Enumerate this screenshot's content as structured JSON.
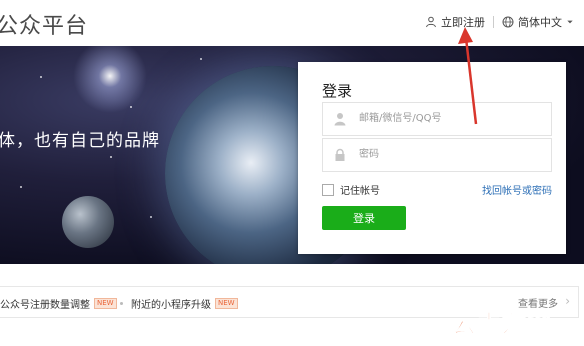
{
  "header": {
    "brand": "公众平台",
    "register_link": "立即注册",
    "language_link": "简体中文"
  },
  "banner": {
    "slogan": "体，也有自己的品牌"
  },
  "login": {
    "title": "登录",
    "account_placeholder": "邮箱/微信号/QQ号",
    "password_placeholder": "密码",
    "remember_label": "记住帐号",
    "forgot_link": "找回帐号或密码",
    "submit_label": "登录",
    "button_color": "#1aad19"
  },
  "notices": {
    "items": [
      {
        "text": "公众号注册数量调整",
        "badge": "NEW"
      },
      {
        "text": "附近的小程序升级",
        "badge": "NEW"
      }
    ],
    "more_label": "查看更多"
  },
  "watermark": "云南龙网",
  "colors": {
    "annotation_arrow": "#d9362c",
    "link": "#2d6fb6"
  },
  "icons": [
    "user-icon",
    "globe-icon",
    "chevron-down-icon",
    "account-icon",
    "lock-icon",
    "chevron-right-icon"
  ]
}
